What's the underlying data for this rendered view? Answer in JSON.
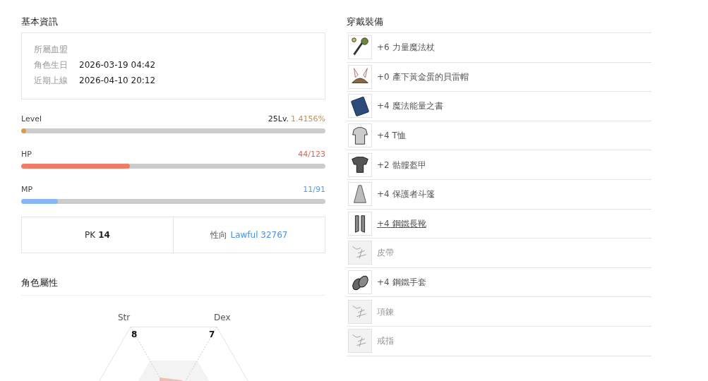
{
  "basic_info": {
    "title": "基本資訊",
    "rows": [
      {
        "label": "所屬血盟",
        "value": ""
      },
      {
        "label": "角色生日",
        "value": "2026-03-19 04:42"
      },
      {
        "label": "近期上線",
        "value": "2026-04-10 20:12"
      }
    ]
  },
  "meters": [
    {
      "kind": "level",
      "label": "Level",
      "reading_prefix": "25Lv.",
      "reading": "1.4156%",
      "level": 0.014
    },
    {
      "kind": "hp",
      "label": "HP",
      "reading": "44/123",
      "level": 0.357
    },
    {
      "kind": "mp",
      "label": "MP",
      "reading": "11/91",
      "level": 0.121
    }
  ],
  "pk": {
    "label": "PK",
    "value": "14"
  },
  "alignment": {
    "label": "性向",
    "value": "Lawful 32767"
  },
  "attributes": {
    "title": "角色屬性",
    "stats": [
      {
        "name": "Str",
        "value": "8"
      },
      {
        "name": "Dex",
        "value": "7"
      }
    ]
  },
  "equipment": {
    "title": "穿戴裝備",
    "items": [
      {
        "kind": "staff",
        "name": "+6 力量魔法杖",
        "hovered": false
      },
      {
        "kind": "hat",
        "name": "+0 產下黃金蛋的貝雷帽",
        "hovered": false
      },
      {
        "kind": "book",
        "name": "+4 魔法能量之書",
        "hovered": false
      },
      {
        "kind": "shirt",
        "name": "+4 T恤",
        "hovered": false
      },
      {
        "kind": "armor",
        "name": "+2 骷髏盔甲",
        "hovered": false
      },
      {
        "kind": "cloak",
        "name": "+4 保護者斗篷",
        "hovered": false
      },
      {
        "kind": "boots",
        "name": "+4 鋼鐵長靴",
        "hovered": true
      },
      {
        "kind": "empty",
        "name": "皮帶",
        "hovered": false
      },
      {
        "kind": "gloves",
        "name": "+4 鋼鐵手套",
        "hovered": false
      },
      {
        "kind": "empty",
        "name": "項鍊",
        "hovered": false
      },
      {
        "kind": "empty",
        "name": "戒指",
        "hovered": false
      }
    ]
  }
}
